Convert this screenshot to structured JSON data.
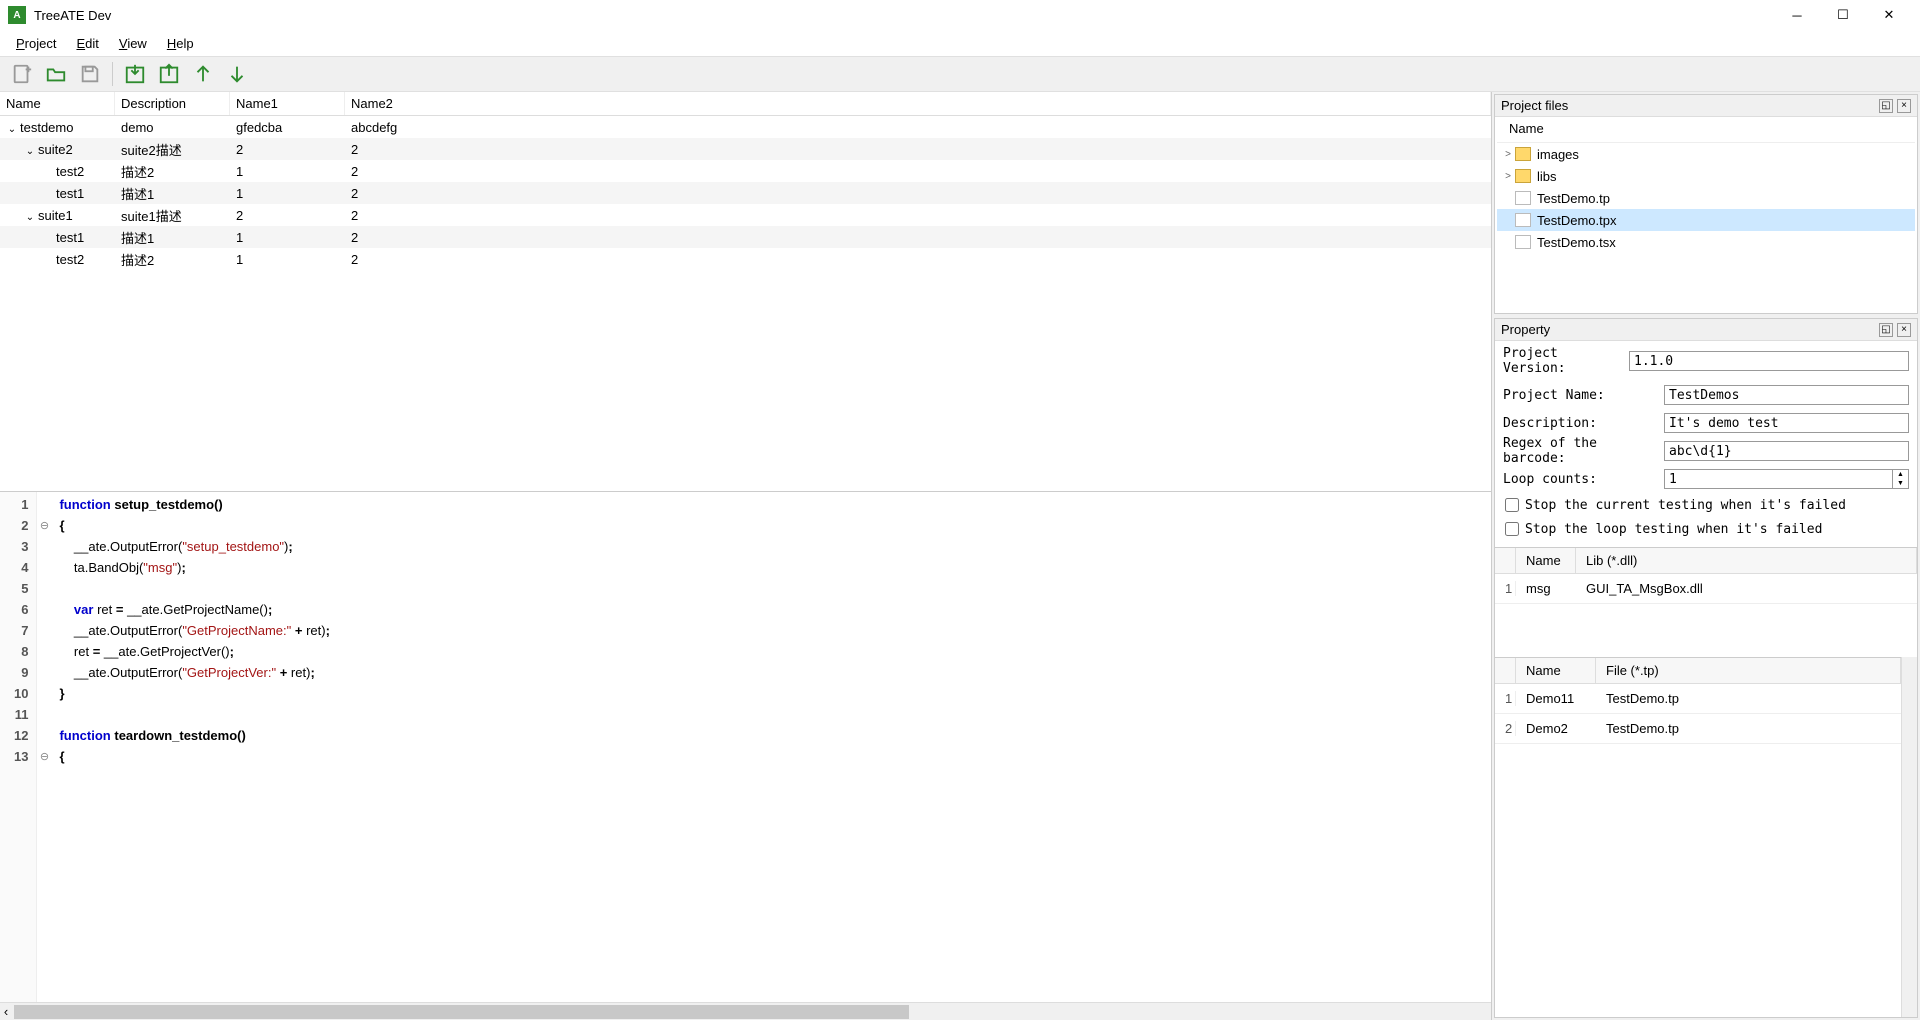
{
  "window": {
    "title": "TreeATE Dev"
  },
  "menu": {
    "project": "Project",
    "edit": "Edit",
    "view": "View",
    "help": "Help"
  },
  "tree": {
    "headers": [
      "Name",
      "Description",
      "Name1",
      "Name2"
    ],
    "rows": [
      {
        "indent": 0,
        "exp": "v",
        "name": "testdemo",
        "desc": "demo",
        "n1": "gfedcba",
        "n2": "abcdefg"
      },
      {
        "indent": 1,
        "exp": "v",
        "name": "suite2",
        "desc": "suite2描述",
        "n1": "2",
        "n2": "2"
      },
      {
        "indent": 2,
        "exp": "",
        "name": "test2",
        "desc": "描述2",
        "n1": "1",
        "n2": "2"
      },
      {
        "indent": 2,
        "exp": "",
        "name": "test1",
        "desc": "描述1",
        "n1": "1",
        "n2": "2"
      },
      {
        "indent": 1,
        "exp": "v",
        "name": "suite1",
        "desc": "suite1描述",
        "n1": "2",
        "n2": "2"
      },
      {
        "indent": 2,
        "exp": "",
        "name": "test1",
        "desc": "描述1",
        "n1": "1",
        "n2": "2"
      },
      {
        "indent": 2,
        "exp": "",
        "name": "test2",
        "desc": "描述2",
        "n1": "1",
        "n2": "2"
      }
    ]
  },
  "code": {
    "lines": [
      {
        "n": 1,
        "fold": "",
        "html": "<span class='kw'>function</span> <span class='fn'>setup_testdemo</span><span class='punct'>()</span>"
      },
      {
        "n": 2,
        "fold": "⊖",
        "html": "<span class='punct'>{</span>"
      },
      {
        "n": 3,
        "fold": "",
        "html": "    __ate.OutputError(<span class='str'>\"setup_testdemo\"</span>)<span class='punct'>;</span>"
      },
      {
        "n": 4,
        "fold": "",
        "html": "    ta.BandObj(<span class='str'>\"msg\"</span>)<span class='punct'>;</span>"
      },
      {
        "n": 5,
        "fold": "",
        "html": ""
      },
      {
        "n": 6,
        "fold": "",
        "html": "    <span class='kw'>var</span> ret <span class='punct'>=</span> __ate.GetProjectName()<span class='punct'>;</span>"
      },
      {
        "n": 7,
        "fold": "",
        "html": "    __ate.OutputError(<span class='str'>\"GetProjectName:\"</span> <span class='punct'>+</span> ret)<span class='punct'>;</span>"
      },
      {
        "n": 8,
        "fold": "",
        "html": "    ret <span class='punct'>=</span> __ate.GetProjectVer()<span class='punct'>;</span>"
      },
      {
        "n": 9,
        "fold": "",
        "html": "    __ate.OutputError(<span class='str'>\"GetProjectVer:\"</span> <span class='punct'>+</span> ret)<span class='punct'>;</span>"
      },
      {
        "n": 10,
        "fold": "",
        "html": "<span class='punct'>}</span>"
      },
      {
        "n": 11,
        "fold": "",
        "html": ""
      },
      {
        "n": 12,
        "fold": "",
        "html": "<span class='kw'>function</span> <span class='fn'>teardown_testdemo</span><span class='punct'>()</span>"
      },
      {
        "n": 13,
        "fold": "⊖",
        "html": "<span class='punct'>{</span>"
      }
    ]
  },
  "projectFiles": {
    "title": "Project files",
    "header": "Name",
    "items": [
      {
        "exp": ">",
        "icon": "folder",
        "name": "images",
        "sel": false
      },
      {
        "exp": ">",
        "icon": "folder",
        "name": "libs",
        "sel": false
      },
      {
        "exp": "",
        "icon": "file",
        "name": "TestDemo.tp",
        "sel": false
      },
      {
        "exp": "",
        "icon": "file",
        "name": "TestDemo.tpx",
        "sel": true
      },
      {
        "exp": "",
        "icon": "file",
        "name": "TestDemo.tsx",
        "sel": false
      }
    ]
  },
  "property": {
    "title": "Property",
    "versionLabel": "Project Version:",
    "version": "1.1.0",
    "nameLabel": "Project Name:",
    "name": "TestDemos",
    "descLabel": "Description:",
    "desc": "It's demo test",
    "regexLabel": "Regex of the barcode:",
    "regex": "abc\\d{1}",
    "loopLabel": "Loop counts:",
    "loop": "1",
    "stopCurrent": "Stop the current testing when it's failed",
    "stopLoop": "Stop the loop testing when it's failed",
    "libTable": {
      "headers": [
        "Name",
        "Lib (*.dll)"
      ],
      "rows": [
        {
          "idx": "1",
          "name": "msg",
          "lib": "GUI_TA_MsgBox.dll"
        }
      ]
    },
    "tpTable": {
      "headers": [
        "Name",
        "File (*.tp)"
      ],
      "rows": [
        {
          "idx": "1",
          "name": "Demo11",
          "file": "TestDemo.tp"
        },
        {
          "idx": "2",
          "name": "Demo2",
          "file": "TestDemo.tp"
        }
      ]
    }
  }
}
